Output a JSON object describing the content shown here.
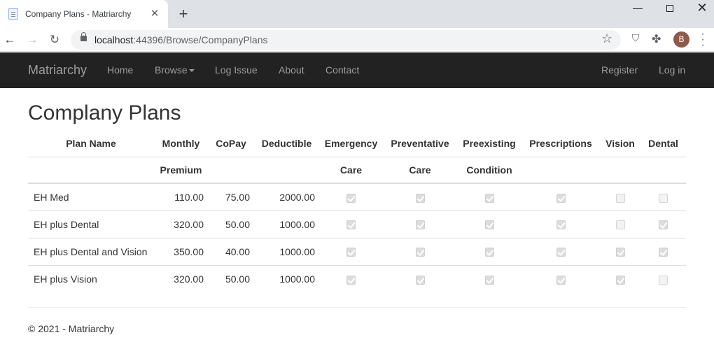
{
  "browser": {
    "tab_title": "Company Plans - Matriarchy",
    "new_tab": "+",
    "url_host": "localhost",
    "url_rest": ":44396/Browse/CompanyPlans",
    "avatar_letter": "B"
  },
  "navbar": {
    "brand": "Matriarchy",
    "links": [
      "Home",
      "Browse",
      "Log Issue",
      "About",
      "Contact"
    ],
    "right_links": [
      "Register",
      "Log in"
    ]
  },
  "page": {
    "title": "Complany Plans"
  },
  "table": {
    "headers": [
      {
        "line1": "Plan Name",
        "line2": ""
      },
      {
        "line1": "Monthly",
        "line2": "Premium"
      },
      {
        "line1": "CoPay",
        "line2": ""
      },
      {
        "line1": "Deductible",
        "line2": ""
      },
      {
        "line1": "Emergency",
        "line2": "Care"
      },
      {
        "line1": "Preventative",
        "line2": "Care"
      },
      {
        "line1": "Preexisting",
        "line2": "Condition"
      },
      {
        "line1": "Prescriptions",
        "line2": ""
      },
      {
        "line1": "Vision",
        "line2": ""
      },
      {
        "line1": "Dental",
        "line2": ""
      }
    ],
    "rows": [
      {
        "name": "EH Med",
        "premium": "110.00",
        "copay": "75.00",
        "deductible": "2000.00",
        "emergency": true,
        "preventative": true,
        "preexisting": true,
        "prescriptions": true,
        "vision": false,
        "dental": false
      },
      {
        "name": "EH plus Dental",
        "premium": "320.00",
        "copay": "50.00",
        "deductible": "1000.00",
        "emergency": true,
        "preventative": true,
        "preexisting": true,
        "prescriptions": true,
        "vision": false,
        "dental": true
      },
      {
        "name": "EH plus Dental and Vision",
        "premium": "350.00",
        "copay": "40.00",
        "deductible": "1000.00",
        "emergency": true,
        "preventative": true,
        "preexisting": true,
        "prescriptions": true,
        "vision": true,
        "dental": true
      },
      {
        "name": "EH plus Vision",
        "premium": "320.00",
        "copay": "50.00",
        "deductible": "1000.00",
        "emergency": true,
        "preventative": true,
        "preexisting": true,
        "prescriptions": true,
        "vision": true,
        "dental": false
      }
    ]
  },
  "footer": {
    "text": "© 2021 - Matriarchy"
  },
  "colors": {
    "navbar_bg": "#222222",
    "nav_text": "#9d9d9d",
    "chrome_bg": "#dee1e6"
  }
}
